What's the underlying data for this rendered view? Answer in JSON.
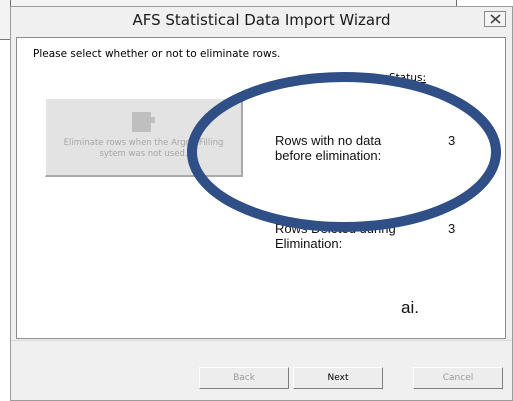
{
  "dialog": {
    "title": "AFS Statistical Data Import Wizard",
    "close_icon": "close-icon"
  },
  "content": {
    "instruction": "Please select whether or not to eliminate rows.",
    "status_label": "Status:",
    "eliminate_button": {
      "icon": "eliminate-rows-icon",
      "label": "Eliminate rows when the Argon Filling sytem was not used.",
      "enabled": false
    },
    "stats": [
      {
        "label_line1": "Rows with no data",
        "label_line2": "before elimination:",
        "value": "3"
      },
      {
        "label_line1": "Rows Deleted during",
        "label_line2": "Elimination:",
        "value": "3"
      }
    ],
    "annotation_note": "ai.",
    "annotation_color": "#2f4f86"
  },
  "footer": {
    "back_label": "Back",
    "next_label": "Next",
    "cancel_label": "Cancel"
  }
}
